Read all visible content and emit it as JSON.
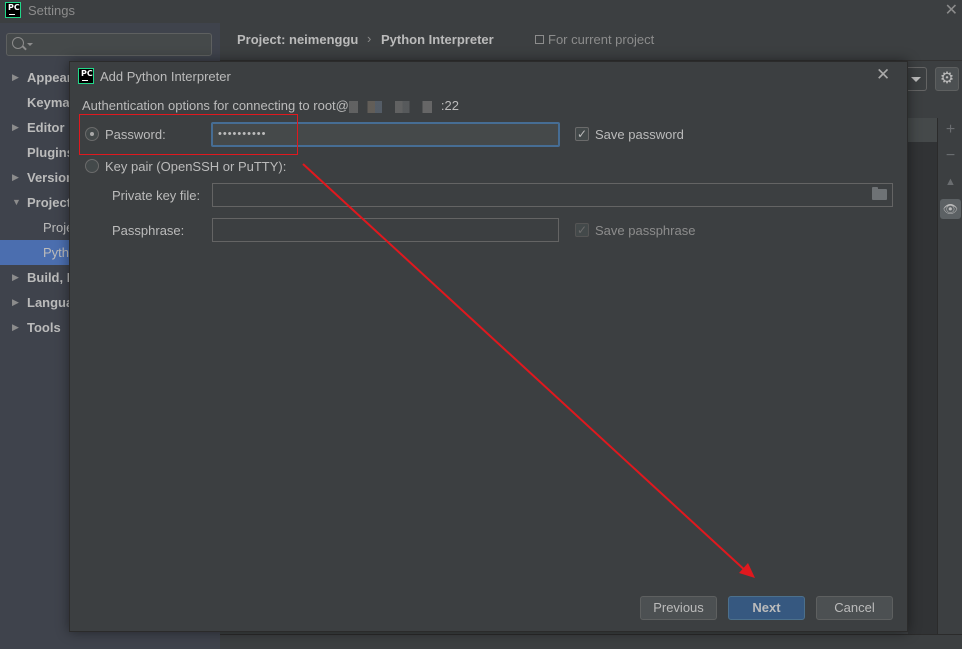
{
  "settings_window": {
    "title": "Settings",
    "close_glyph": "✕",
    "search": {
      "placeholder": "",
      "value": ""
    },
    "sidebar": {
      "items": [
        {
          "label": "Appearance & Behavior",
          "arrow": "▶",
          "level": 0
        },
        {
          "label": "Keymap",
          "arrow": "",
          "level": 0
        },
        {
          "label": "Editor",
          "arrow": "▶",
          "level": 0
        },
        {
          "label": "Plugins",
          "arrow": "",
          "level": 0
        },
        {
          "label": "Version Control",
          "arrow": "▶",
          "level": 0
        },
        {
          "label": "Project: neimenggu",
          "arrow": "▼",
          "level": 0
        },
        {
          "label": "Project Structure",
          "arrow": "",
          "level": 1
        },
        {
          "label": "Python Interpreter",
          "arrow": "",
          "level": 1,
          "selected": true
        },
        {
          "label": "Build, Execution, Deployment",
          "arrow": "▶",
          "level": 0
        },
        {
          "label": "Languages & Frameworks",
          "arrow": "▶",
          "level": 0
        },
        {
          "label": "Tools",
          "arrow": "▶",
          "level": 0
        }
      ]
    },
    "header": {
      "breadcrumb_project": "Project: neimenggu",
      "breadcrumb_separator": "›",
      "breadcrumb_page": "Python Interpreter",
      "scope_label": "For current project"
    },
    "toolbar": {
      "gear_glyph": "⚙",
      "add_glyph": "+",
      "remove_glyph": "−",
      "upgrade_glyph": "▲",
      "show_glyph": "👁"
    }
  },
  "dialog": {
    "title": "Add Python Interpreter",
    "close_glyph": "✕",
    "auth_prefix": "Authentication options for connecting to root@",
    "auth_suffix": ":22",
    "password_option": {
      "label": "Password:",
      "selected": true
    },
    "password_field": {
      "value": "••••••••••"
    },
    "save_password": {
      "label": "Save password",
      "checked": true,
      "glyph": "✓"
    },
    "keypair_option": {
      "label": "Key pair (OpenSSH or PuTTY):",
      "selected": false
    },
    "private_key_file": {
      "label": "Private key file:",
      "value": ""
    },
    "passphrase": {
      "label": "Passphrase:",
      "value": ""
    },
    "save_passphrase": {
      "label": "Save passphrase",
      "checked": true,
      "disabled": true,
      "glyph": "✓"
    },
    "buttons": {
      "previous": "Previous",
      "next": "Next",
      "cancel": "Cancel"
    }
  },
  "logo_text": "PC",
  "colors": {
    "background": "#3c3f41",
    "sidebar": "#3f434c",
    "selection": "#4b6eaf",
    "primary_button": "#365880",
    "focus_border": "#466d94",
    "annotation_red": "#e0181e",
    "logo_border": "#21d789"
  }
}
